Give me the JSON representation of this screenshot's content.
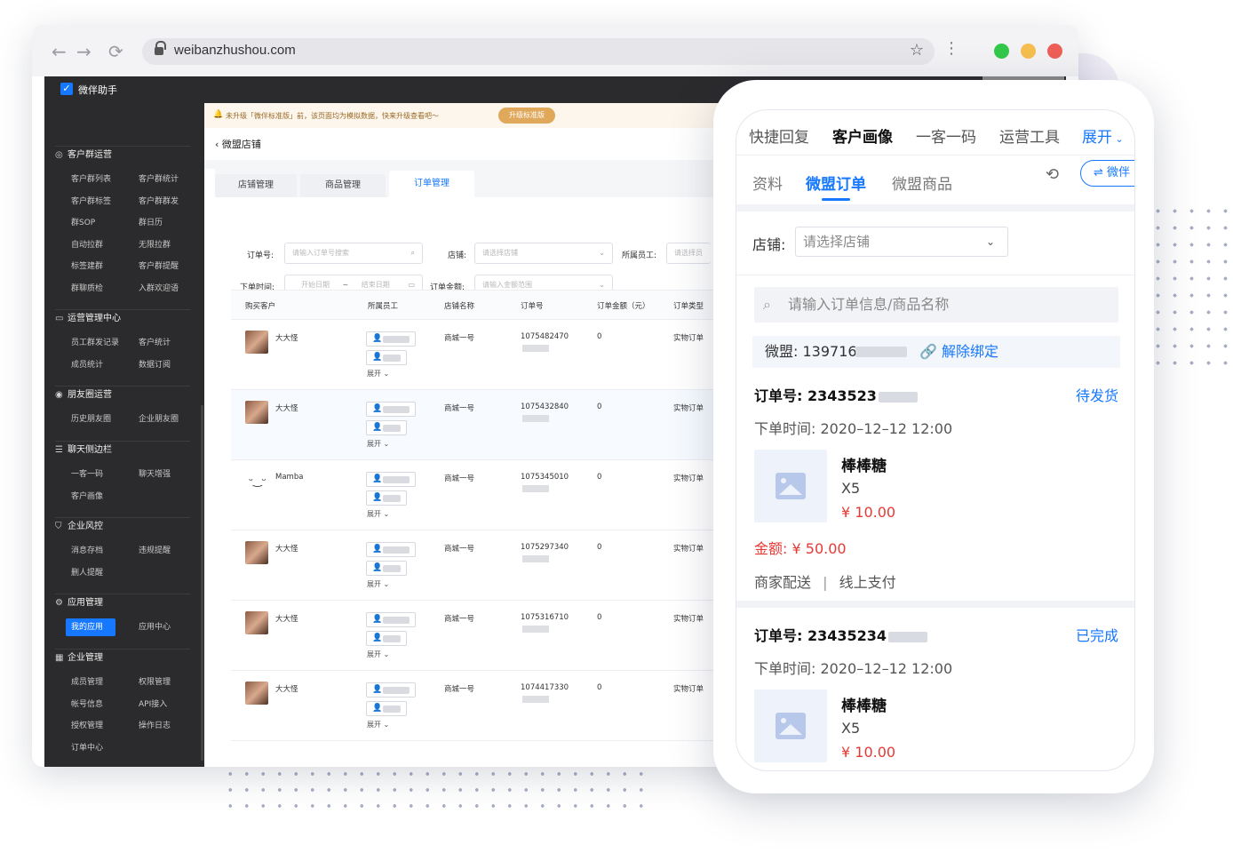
{
  "browser": {
    "url": "weibanzhushou.com"
  },
  "app": {
    "brand": "微伴助手",
    "notice": "未升级「微伴标准版」前，该页面均为模拟数据，快来升级查看吧～",
    "upgrade_label": "升级标准版",
    "breadcrumb": "微盟店铺"
  },
  "sidebar": {
    "groups": [
      {
        "title": "客户群运营",
        "items": [
          "客户群列表",
          "客户群统计",
          "客户群标签",
          "客户群群发",
          "群SOP",
          "群日历",
          "自动拉群",
          "无限拉群",
          "标签建群",
          "客户群提醒",
          "群聊质检",
          "入群欢迎语"
        ]
      },
      {
        "title": "运营管理中心",
        "items": [
          "员工群发记录",
          "客户统计",
          "成员统计",
          "数据订阅"
        ]
      },
      {
        "title": "朋友圈运营",
        "items": [
          "历史朋友圈",
          "企业朋友圈"
        ]
      },
      {
        "title": "聊天侧边栏",
        "items": [
          "一客一码",
          "聊天增强",
          "客户画像"
        ]
      },
      {
        "title": "企业风控",
        "items": [
          "消息存档",
          "违规提醒",
          "删人提醒"
        ]
      },
      {
        "title": "应用管理",
        "items": [
          "我的应用",
          "应用中心"
        ]
      },
      {
        "title": "企业管理",
        "items": [
          "成员管理",
          "权限管理",
          "帐号信息",
          "API接入",
          "授权管理",
          "操作日志",
          "订单中心"
        ]
      }
    ]
  },
  "tabs": [
    "店铺管理",
    "商品管理",
    "订单管理"
  ],
  "filters": {
    "order_no_label": "订单号:",
    "order_no_placeholder": "请输入订单号搜索",
    "shop_label": "店铺:",
    "shop_placeholder": "请选择店铺",
    "staff_label": "所属员工:",
    "staff_placeholder": "请选择员",
    "time_label": "下单时间:",
    "start_placeholder": "开始日期",
    "range_sep": "~",
    "end_placeholder": "结束日期",
    "amount_label": "订单金额:",
    "amount_placeholder": "请输入金额范围"
  },
  "table": {
    "headers": [
      "购买客户",
      "所属员工",
      "店铺名称",
      "订单号",
      "订单金额（元）",
      "订单类型"
    ],
    "expand_label": "展开",
    "rows": [
      {
        "customer": "大大怪",
        "shop": "商城一号",
        "order_no": "1075482470",
        "amount": "0",
        "type": "实物订单"
      },
      {
        "customer": "大大怪",
        "shop": "商城一号",
        "order_no": "1075432840",
        "amount": "0",
        "type": "实物订单"
      },
      {
        "customer": "Mamba",
        "shop": "商城一号",
        "order_no": "1075345010",
        "amount": "0",
        "type": "实物订单"
      },
      {
        "customer": "大大怪",
        "shop": "商城一号",
        "order_no": "1075297340",
        "amount": "0",
        "type": "实物订单"
      },
      {
        "customer": "大大怪",
        "shop": "商城一号",
        "order_no": "1075316710",
        "amount": "0",
        "type": "实物订单"
      },
      {
        "customer": "大大怪",
        "shop": "商城一号",
        "order_no": "1074417330",
        "amount": "0",
        "type": "实物订单"
      }
    ]
  },
  "phone": {
    "top_tabs": [
      "快捷回复",
      "客户画像",
      "一客一码",
      "运营工具",
      "展开"
    ],
    "sub_tabs": [
      "资料",
      "微盟订单",
      "微盟商品"
    ],
    "weixin_btn": "⇌ 微伴",
    "shop_label": "店铺:",
    "shop_placeholder": "请选择店铺",
    "search_placeholder": "请输入订单信息/商品名称",
    "weimeng_label": "微盟:",
    "weimeng_value": "139716",
    "unbind_label": "解除绑定",
    "orders": [
      {
        "no_label": "订单号:",
        "no": "2343523",
        "status": "待发货",
        "time_label": "下单时间:",
        "time": "2020–12–12 12:00",
        "product": "棒棒糖",
        "qty": "X5",
        "price": "¥ 10.00",
        "amount_label": "金额:",
        "amount": "¥ 50.00",
        "delivery": "商家配送",
        "sep": "|",
        "payment": "线上支付"
      },
      {
        "no_label": "订单号:",
        "no": "23435234",
        "status": "已完成",
        "time_label": "下单时间:",
        "time": "2020–12–12 12:00",
        "product": "棒棒糖",
        "qty": "X5",
        "price": "¥ 10.00"
      }
    ]
  },
  "colors": {
    "accent": "#1677ff",
    "price": "#e53935",
    "sidebar_bg": "#2b2b2d"
  }
}
